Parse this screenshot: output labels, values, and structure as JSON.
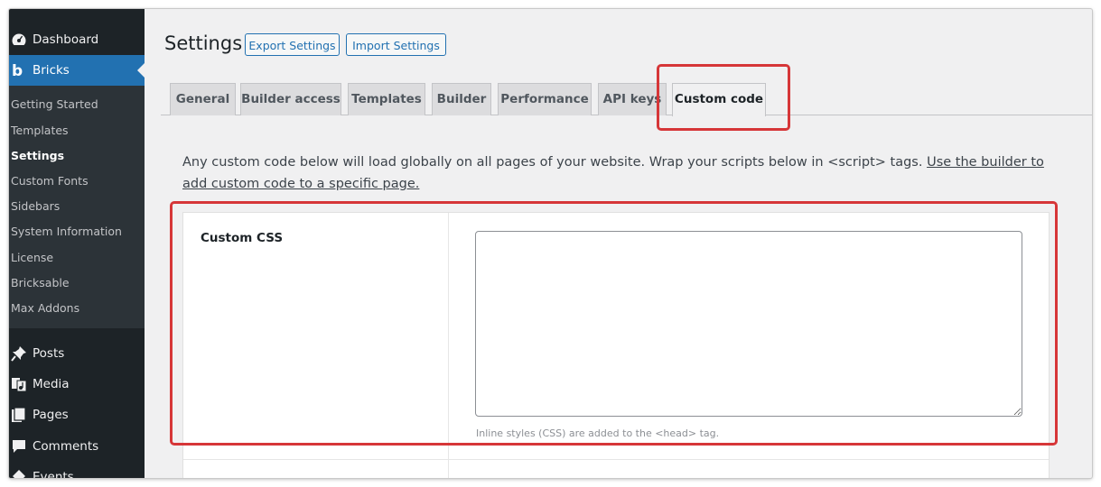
{
  "sidebar": {
    "top_items": [
      {
        "label": "Dashboard",
        "icon": "dashboard-icon"
      },
      {
        "label": "Bricks",
        "icon": "bricks-icon"
      }
    ],
    "submenu": [
      {
        "label": "Getting Started"
      },
      {
        "label": "Templates"
      },
      {
        "label": "Settings"
      },
      {
        "label": "Custom Fonts"
      },
      {
        "label": "Sidebars"
      },
      {
        "label": "System Information"
      },
      {
        "label": "License"
      },
      {
        "label": "Bricksable"
      },
      {
        "label": "Max Addons"
      }
    ],
    "bottom_items": [
      {
        "label": "Posts",
        "icon": "pushpin-icon"
      },
      {
        "label": "Media",
        "icon": "media-icon"
      },
      {
        "label": "Pages",
        "icon": "pages-icon"
      },
      {
        "label": "Comments",
        "icon": "comments-icon"
      },
      {
        "label": "Events",
        "icon": "events-icon"
      }
    ]
  },
  "header": {
    "title": "Settings",
    "export_label": "Export Settings",
    "import_label": "Import Settings"
  },
  "tabs": [
    {
      "label": "General"
    },
    {
      "label": "Builder access"
    },
    {
      "label": "Templates"
    },
    {
      "label": "Builder"
    },
    {
      "label": "Performance"
    },
    {
      "label": "API keys"
    },
    {
      "label": "Custom code"
    }
  ],
  "active_tab": "Custom code",
  "intro": {
    "text": "Any custom code below will load globally on all pages of your website. Wrap your scripts below in <script> tags. ",
    "link": "Use the builder to add custom code to a specific page."
  },
  "custom_css": {
    "label": "Custom CSS",
    "value": "",
    "help": "Inline styles (CSS) are added to the <head> tag."
  },
  "colors": {
    "sidebar_bg": "#1d2327",
    "accent": "#2271b1",
    "highlight": "#d63638"
  }
}
